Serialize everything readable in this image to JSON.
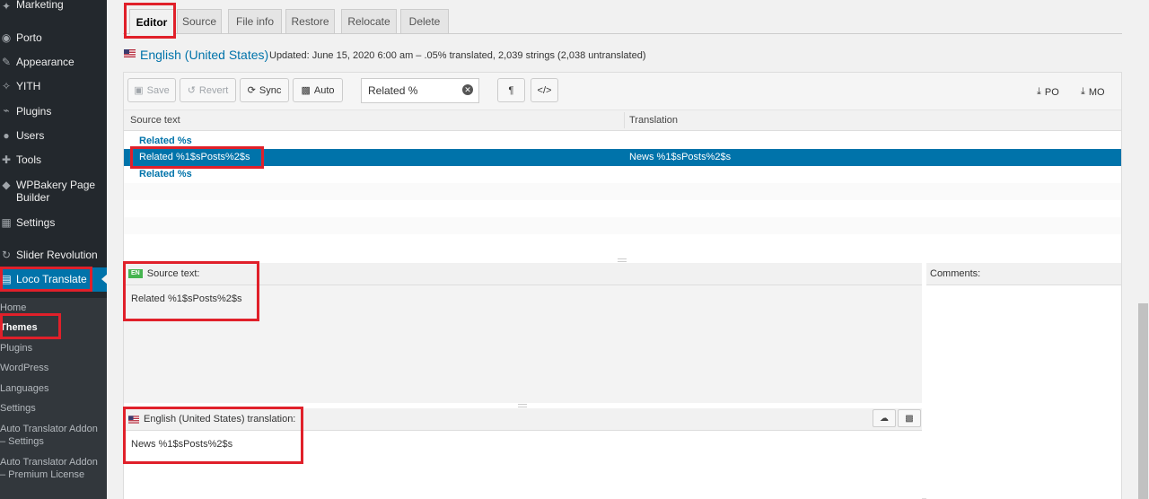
{
  "sidebar": {
    "items": [
      {
        "label": "Marketing",
        "icon": "megaphone-icon"
      },
      {
        "label": "Porto",
        "icon": "porto-icon"
      },
      {
        "label": "Appearance",
        "icon": "paintbrush-icon"
      },
      {
        "label": "YITH",
        "icon": "yith-icon"
      },
      {
        "label": "Plugins",
        "icon": "plugin-icon"
      },
      {
        "label": "Users",
        "icon": "users-icon"
      },
      {
        "label": "Tools",
        "icon": "wrench-icon"
      },
      {
        "label": "WPBakery Page Builder",
        "icon": "wpbakery-icon"
      },
      {
        "label": "Settings",
        "icon": "settings-icon"
      },
      {
        "label": "Slider Revolution",
        "icon": "slider-revolution-icon"
      },
      {
        "label": "Loco Translate",
        "icon": "loco-translate-icon"
      }
    ],
    "submenu": [
      "Home",
      "Themes",
      "Plugins",
      "WordPress",
      "Languages",
      "Settings",
      "Auto Translator Addon – Settings",
      "Auto Translator Addon – Premium License"
    ],
    "current_submenu": "Themes"
  },
  "tabs": [
    "Editor",
    "Source",
    "File info",
    "Restore",
    "Relocate",
    "Delete"
  ],
  "active_tab": "Editor",
  "heading": {
    "language": "English (United States)",
    "updated": "Updated: June 15, 2020 6:00 am – .05% translated, 2,039 strings (2,038 untranslated)"
  },
  "toolbar": {
    "save": "Save",
    "revert": "Revert",
    "sync": "Sync",
    "auto": "Auto",
    "filter_value": "Related %",
    "pilcrow": "¶",
    "code": "</>",
    "po": "PO",
    "mo": "MO"
  },
  "grid": {
    "source_header": "Source text",
    "translation_header": "Translation",
    "rows": [
      {
        "source": "Related %s",
        "translation": ""
      },
      {
        "source": "Related %1$sPosts%2$s",
        "translation": "News %1$sPosts%2$s"
      },
      {
        "source": "Related %s",
        "translation": ""
      }
    ],
    "selected_index": 1
  },
  "source_panel": {
    "badge": "EN",
    "title": "Source text:",
    "text": "Related %1$sPosts%2$s"
  },
  "comments_panel": {
    "title": "Comments:"
  },
  "translation_panel": {
    "title": "English (United States) translation:",
    "text": "News %1$sPosts%2$s"
  },
  "colors": {
    "sidebar_bg": "#23282d",
    "submenu_bg": "#32373c",
    "accent": "#0073aa",
    "highlight": "#e0202a"
  }
}
